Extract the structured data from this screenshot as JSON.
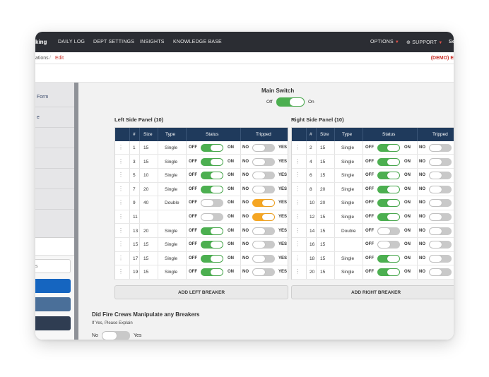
{
  "topbar": {
    "brand": "king",
    "nav": [
      "DAILY LOG",
      "DEPT SETTINGS",
      "INSIGHTS",
      "KNOWLEDGE BASE"
    ],
    "options": "OPTIONS",
    "support": "SUPPORT",
    "right_fragment": "Se"
  },
  "breadcrumb": {
    "crumb_1": "ations",
    "separator": "/",
    "crumb_2": "Edit",
    "demo": "(DEMO) E"
  },
  "sidebar": {
    "items": [
      "Form",
      "e"
    ],
    "input_value": "s"
  },
  "main_switch": {
    "title": "Main Switch",
    "off_label": "Off",
    "on_label": "On",
    "state": "on"
  },
  "left_panel": {
    "title": "Left Side Panel (10)",
    "add_label": "ADD LEFT BREAKER",
    "rows": [
      {
        "num": "1",
        "size": "15",
        "type": "Single",
        "status": "on",
        "tripped": "off"
      },
      {
        "num": "3",
        "size": "15",
        "type": "Single",
        "status": "on",
        "tripped": "off"
      },
      {
        "num": "5",
        "size": "10",
        "type": "Single",
        "status": "on",
        "tripped": "off"
      },
      {
        "num": "7",
        "size": "20",
        "type": "Single",
        "status": "on",
        "tripped": "off"
      },
      {
        "num": "9",
        "size": "40",
        "type": "Double",
        "status": "off",
        "tripped": "on"
      },
      {
        "num": "11",
        "size": "",
        "type": "",
        "status": "off",
        "tripped": "on"
      },
      {
        "num": "13",
        "size": "20",
        "type": "Single",
        "status": "on",
        "tripped": "off"
      },
      {
        "num": "15",
        "size": "15",
        "type": "Single",
        "status": "on",
        "tripped": "off"
      },
      {
        "num": "17",
        "size": "15",
        "type": "Single",
        "status": "on",
        "tripped": "off"
      },
      {
        "num": "19",
        "size": "15",
        "type": "Single",
        "status": "on",
        "tripped": "off"
      }
    ]
  },
  "right_panel": {
    "title": "Right Side Panel (10)",
    "add_label": "ADD RIGHT BREAKER",
    "rows": [
      {
        "num": "2",
        "size": "15",
        "type": "Single",
        "status": "on",
        "tripped": "off"
      },
      {
        "num": "4",
        "size": "15",
        "type": "Single",
        "status": "on",
        "tripped": "off"
      },
      {
        "num": "6",
        "size": "15",
        "type": "Single",
        "status": "on",
        "tripped": "off"
      },
      {
        "num": "8",
        "size": "20",
        "type": "Single",
        "status": "on",
        "tripped": "off"
      },
      {
        "num": "10",
        "size": "20",
        "type": "Single",
        "status": "on",
        "tripped": "off"
      },
      {
        "num": "12",
        "size": "15",
        "type": "Single",
        "status": "on",
        "tripped": "off"
      },
      {
        "num": "14",
        "size": "15",
        "type": "Double",
        "status": "off",
        "tripped": "off"
      },
      {
        "num": "16",
        "size": "15",
        "type": "",
        "status": "off",
        "tripped": "off"
      },
      {
        "num": "18",
        "size": "15",
        "type": "Single",
        "status": "on",
        "tripped": "off"
      },
      {
        "num": "20",
        "size": "15",
        "type": "Single",
        "status": "on",
        "tripped": "off"
      }
    ]
  },
  "table_headers": {
    "num": "#",
    "size": "Size",
    "type": "Type",
    "status": "Status",
    "tripped": "Tripped"
  },
  "toggle_labels": {
    "off": "OFF",
    "on": "ON",
    "no": "NO",
    "yes": "YES"
  },
  "fire": {
    "question": "Did Fire Crews Manipulate any Breakers",
    "hint": "If Yes, Please Explain",
    "no_label": "No",
    "yes_label": "Yes",
    "state": "off"
  },
  "colors": {
    "navbar": "#2b2d33",
    "table_header": "#1f3a5c",
    "toggle_green": "#4caf50",
    "toggle_orange": "#f5a623",
    "toggle_grey": "#c9c9c9",
    "accent_red": "#c8322b",
    "side_btn_1": "#1565c0",
    "side_btn_2": "#4a6f99",
    "side_btn_3": "#2f3d52"
  }
}
